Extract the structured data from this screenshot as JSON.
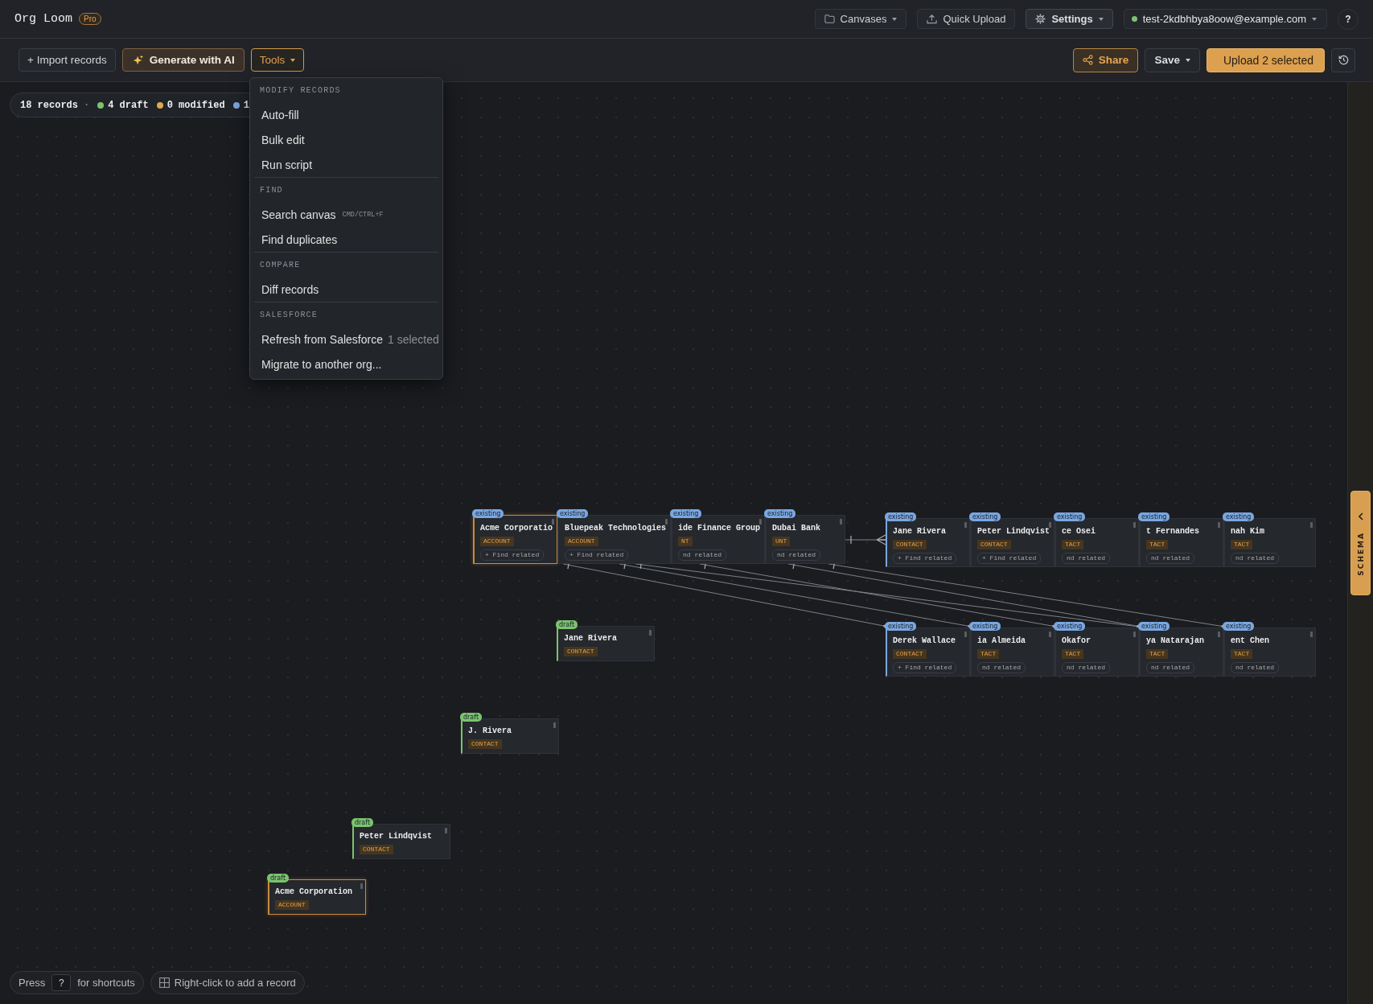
{
  "app": {
    "name": "Org Loom",
    "plan": "Pro"
  },
  "header": {
    "buttons": [
      {
        "kind": "canvases",
        "label": "Canvases",
        "menu": true
      },
      {
        "kind": "upload",
        "label": "Quick Upload",
        "menu": false
      },
      {
        "kind": "settings",
        "label": "Settings",
        "menu": true
      },
      {
        "kind": "account",
        "label": "test-2kdbhbya8oow@example.com",
        "menu": true,
        "online": true
      }
    ],
    "help": "?"
  },
  "toolbar": {
    "left": [
      {
        "kind": "import",
        "label": "+ Import records",
        "menu": false
      },
      {
        "kind": "ai",
        "label": "Generate with AI",
        "menu": false
      },
      {
        "kind": "tools",
        "label": "Tools",
        "menu": true,
        "expanded": true
      }
    ],
    "right": [
      {
        "kind": "share",
        "label": "Share",
        "menu": false
      },
      {
        "kind": "save",
        "label": "Save",
        "menu": true
      },
      {
        "kind": "upload",
        "label": "Upload 2 selected",
        "menu": false
      },
      {
        "kind": "history",
        "menu": false
      }
    ]
  },
  "status_pill": {
    "count": "18 records",
    "separator": "·",
    "states": [
      {
        "label": "4 draft",
        "color": "#7cc36e"
      },
      {
        "label": "0 modified",
        "color": "#e0a84e"
      },
      {
        "label": "1",
        "color": "#7aa7e0"
      }
    ]
  },
  "tools_menu": {
    "sections": [
      {
        "heading": "MODIFY RECORDS",
        "items": [
          {
            "label": "Auto-fill"
          },
          {
            "label": "Bulk edit"
          },
          {
            "label": "Run script"
          }
        ]
      },
      {
        "heading": "FIND",
        "items": [
          {
            "label": "Search canvas",
            "shortcut": "CMD/CTRL+F"
          },
          {
            "label": "Find duplicates"
          }
        ]
      },
      {
        "heading": "COMPARE",
        "items": [
          {
            "label": "Diff records"
          }
        ]
      },
      {
        "heading": "SALESFORCE",
        "items": [
          {
            "label": "Refresh from Salesforce",
            "note": "1 selected"
          },
          {
            "label": "Migrate to another org..."
          }
        ]
      }
    ]
  },
  "canvas": {
    "rows": [
      {
        "nodes": [
          {
            "kind": "existing",
            "badge": "existing",
            "title": "Acme Corporatio",
            "type": "ACCOUNT",
            "chip": "+ Find related",
            "selected": true
          },
          {
            "kind": "existing",
            "badge": "existing",
            "title": "Bluepeak Technologies",
            "type": "ACCOUNT",
            "chip": "+ Find related",
            "selected": false
          },
          {
            "kind": "existing",
            "badge": "existing",
            "title": "ide Finance Group",
            "type": "NT",
            "chip": "nd related",
            "selected": false
          },
          {
            "kind": "existing",
            "badge": "existing",
            "title": "Dubai Bank",
            "type": "UNT",
            "chip": "nd related",
            "selected": false
          }
        ]
      },
      {
        "nodes": [
          {
            "kind": "existing",
            "badge": "existing",
            "title": "Jane Rivera",
            "type": "CONTACT",
            "chip": "+ Find related",
            "selected": false
          },
          {
            "kind": "existing",
            "badge": "existing",
            "title": "Peter Lindqvist",
            "type": "CONTACT",
            "chip": "+ Find related",
            "selected": false
          },
          {
            "kind": "existing",
            "badge": "existing",
            "title": "ce Osei",
            "type": "TACT",
            "chip": "nd related",
            "selected": false
          },
          {
            "kind": "existing",
            "badge": "existing",
            "title": "t Fernandes",
            "type": "TACT",
            "chip": "nd related",
            "selected": false
          },
          {
            "kind": "existing",
            "badge": "existing",
            "title": "nah Kim",
            "type": "TACT",
            "chip": "nd related",
            "selected": false
          }
        ]
      },
      {
        "nodes": [
          {
            "kind": "existing",
            "badge": "existing",
            "title": "Derek Wallace",
            "type": "CONTACT",
            "chip": "+ Find related",
            "selected": false
          },
          {
            "kind": "existing",
            "badge": "existing",
            "title": "ia Almeida",
            "type": "TACT",
            "chip": "nd related",
            "selected": false
          },
          {
            "kind": "existing",
            "badge": "existing",
            "title": "Okafor",
            "type": "TACT",
            "chip": "nd related",
            "selected": false
          },
          {
            "kind": "existing",
            "badge": "existing",
            "title": "ya Natarajan",
            "type": "TACT",
            "chip": "nd related",
            "selected": false
          },
          {
            "kind": "existing",
            "badge": "existing",
            "title": "ent Chen",
            "type": "TACT",
            "chip": "nd related",
            "selected": false
          }
        ]
      }
    ],
    "nodes": [
      {
        "kind": "draft",
        "badge": "draft",
        "title": "Jane Rivera",
        "type": "CONTACT",
        "selected": false
      },
      {
        "kind": "draft",
        "badge": "draft",
        "title": "J. Rivera",
        "type": "CONTACT",
        "selected": false
      },
      {
        "kind": "draft",
        "badge": "draft",
        "title": "Peter Lindqvist",
        "type": "CONTACT",
        "selected": false
      },
      {
        "kind": "draft",
        "badge": "draft",
        "title": "Acme Corporation",
        "type": "ACCOUNT",
        "selected": true
      }
    ]
  },
  "hints": [
    {
      "kind": "shortcuts",
      "before": "Press",
      "key": "?",
      "after": "for shortcuts"
    },
    {
      "kind": "add",
      "text": "Right-click to add a record"
    }
  ],
  "schema_panel": {
    "label": "SCHEMA",
    "expanded": false
  }
}
